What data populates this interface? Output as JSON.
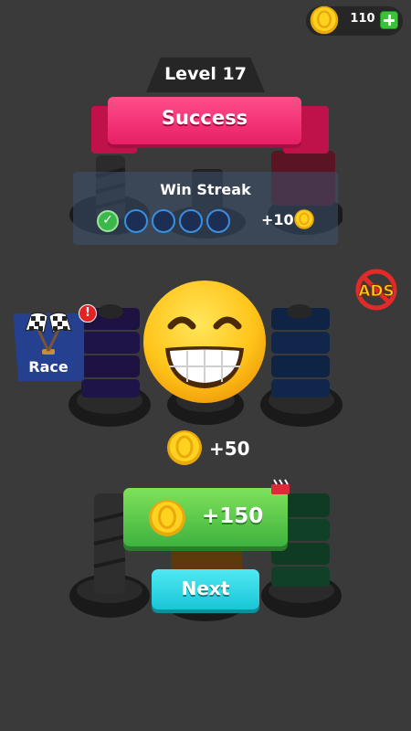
{
  "hud": {
    "coins": "110"
  },
  "level": {
    "label": "Level 17"
  },
  "result": {
    "title": "Success"
  },
  "win_streak": {
    "title": "Win Streak",
    "reward": "+10",
    "steps_completed": 1,
    "steps_total": 5
  },
  "race": {
    "label": "Race",
    "badge": "!"
  },
  "no_ads": {
    "label": "ADS"
  },
  "reward": {
    "amount": "+50"
  },
  "bonus": {
    "amount": "+150"
  },
  "next": {
    "label": "Next"
  },
  "colors": {
    "success": "#ff3b7d",
    "bonus": "#5fd34a",
    "next": "#27d4e3",
    "coin": "#f6c21c"
  }
}
